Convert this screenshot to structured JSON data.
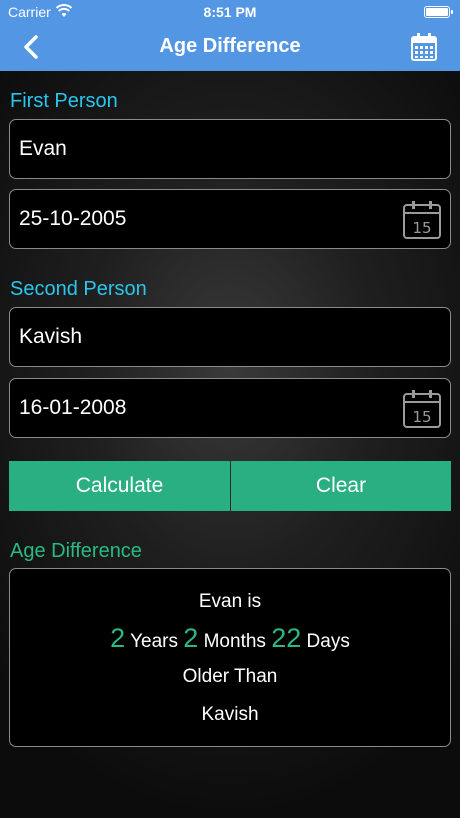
{
  "status": {
    "carrier": "Carrier",
    "time": "8:51 PM"
  },
  "nav": {
    "title": "Age Difference",
    "back_icon": "chevron-left-icon",
    "calendar_icon": "calendar-icon"
  },
  "first": {
    "label": "First Person",
    "name": "Evan",
    "date": "25-10-2005"
  },
  "second": {
    "label": "Second Person",
    "name": "Kavish",
    "date": "16-01-2008"
  },
  "buttons": {
    "calculate": "Calculate",
    "clear": "Clear"
  },
  "result": {
    "label": "Age Difference",
    "line1": "Evan is",
    "years_num": "2",
    "years_word": " Years ",
    "months_num": "2",
    "months_word": " Months ",
    "days_num": "22",
    "days_word": " Days",
    "line3": "Older Than",
    "line4": "Kavish"
  },
  "colors": {
    "nav": "#5296e4",
    "accent_cyan": "#29c6ee",
    "accent_green": "#2aba85",
    "button": "#2aaf82"
  }
}
